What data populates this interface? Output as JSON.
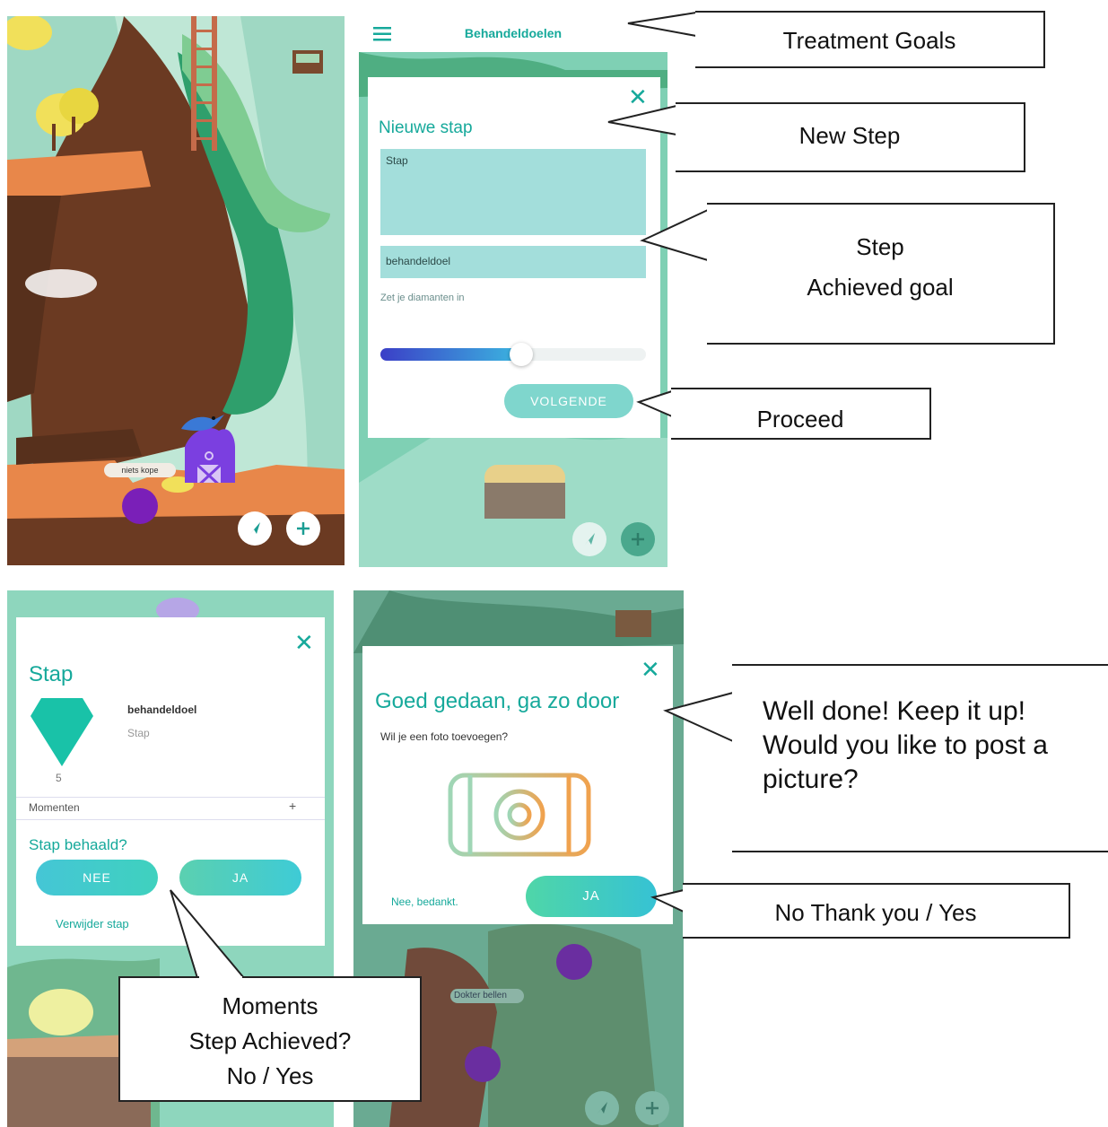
{
  "screen1": {
    "node_label": "niets kope"
  },
  "screen2": {
    "header_title": "Behandeldoelen",
    "card_title": "Nieuwe stap",
    "step_field": "Stap",
    "goal_field": "behandeldoel",
    "diamonds_label": "Zet je diamanten in",
    "slider_value": 0.53,
    "next_button": "VOLGENDE"
  },
  "screen3": {
    "card_title": "Stap",
    "goal_name": "behandeldoel",
    "step_name": "Stap",
    "diamond_count": "5",
    "moments_label": "Momenten",
    "moments_add": "+",
    "achieved_question": "Stap behaald?",
    "no_button": "NEE",
    "yes_button": "JA",
    "delete_link": "Verwijder stap"
  },
  "screen4": {
    "card_title": "Goed gedaan, ga zo door",
    "photo_question": "Wil je een foto toevoegen?",
    "no_thanks": "Nee, bedankt.",
    "yes_button": "JA",
    "bg_label_1": "Dokter bellen"
  },
  "callouts": {
    "treatment_goals": "Treatment Goals",
    "new_step": "New Step",
    "step_line1": "Step",
    "step_line2": "Achieved goal",
    "proceed": "Proceed",
    "well_done_line1": "Well done! Keep it up!",
    "well_done_line2": "Would you like to post a",
    "well_done_line3": "picture?",
    "no_thank_yes": "No Thank you / Yes",
    "moments_line1": "Moments",
    "moments_line2": "Step Achieved?",
    "moments_line3": "No / Yes"
  },
  "colors": {
    "teal": "#16a99b",
    "field": "#a3dedb",
    "button": "#3fc9c0",
    "forest": "#5cbf9a",
    "trunk": "#6b3a22"
  },
  "icons": [
    "menu-icon",
    "close-icon",
    "navigate-icon",
    "plus-icon",
    "camera-icon",
    "diamond-icon",
    "bird-icon",
    "barn-icon"
  ]
}
